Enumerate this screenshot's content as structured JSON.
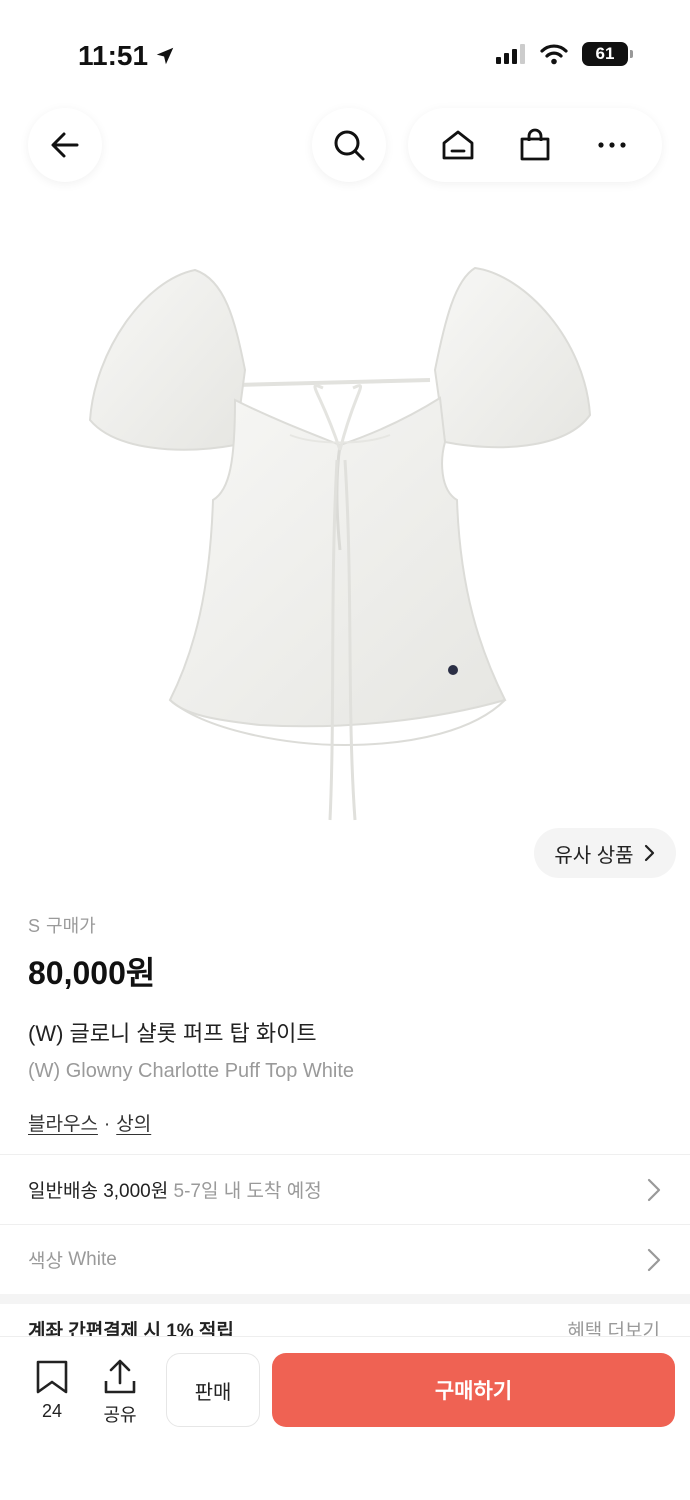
{
  "status": {
    "time": "11:51",
    "battery": "61"
  },
  "price": {
    "size_prefix": "S",
    "label": "구매가",
    "value": "80,000원"
  },
  "product": {
    "name_ko": "(W) 글로니 샬롯 퍼프 탑 화이트",
    "name_en": "(W) Glowny Charlotte Puff Top White"
  },
  "category": {
    "primary": "블라우스",
    "separator": "·",
    "secondary": "상의"
  },
  "similar_button": "유사 상품",
  "shipping": {
    "label": "일반배송 3,000원",
    "eta": "5-7일 내 도착 예정"
  },
  "color": {
    "label": "색상",
    "value": "White"
  },
  "benefit": {
    "title": "계좌 간편결제 시 1% 적립",
    "more": "혜택 더보기"
  },
  "bottom": {
    "bookmark_count": "24",
    "share_label": "공유",
    "sell_label": "판매",
    "buy_label": "구매하기"
  },
  "colors": {
    "buy": "#ef6253"
  },
  "icons": [
    "location-arrow-icon",
    "signal-icon",
    "wifi-icon",
    "battery-icon",
    "back-arrow-icon",
    "search-icon",
    "home-icon",
    "shopping-bag-icon",
    "more-icon",
    "chevron-right-icon",
    "bookmark-icon",
    "share-icon"
  ]
}
